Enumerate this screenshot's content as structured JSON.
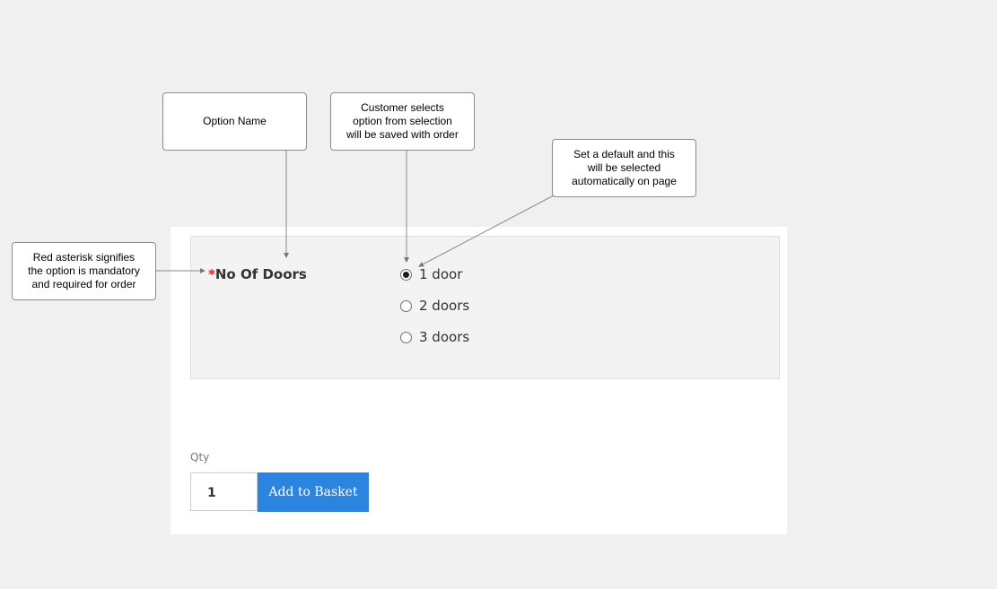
{
  "callouts": {
    "option_name": "Option Name",
    "customer_selects": "Customer selects\noption from selection\nwill be saved with order",
    "set_default": "Set a default and this\nwill be selected\nautomatically on page",
    "red_asterisk": "Red asterisk signifies\nthe option is mandatory\nand required for order"
  },
  "option": {
    "asterisk": "*",
    "label": "No Of Doors",
    "choices": [
      {
        "label": "1 door",
        "selected": true
      },
      {
        "label": "2 doors",
        "selected": false
      },
      {
        "label": "3 doors",
        "selected": false
      }
    ]
  },
  "purchase": {
    "qty_label": "Qty",
    "qty_value": "1",
    "add_button": "Add to Basket"
  },
  "colors": {
    "asterisk": "#e01b1b",
    "button": "#2a84e0"
  }
}
